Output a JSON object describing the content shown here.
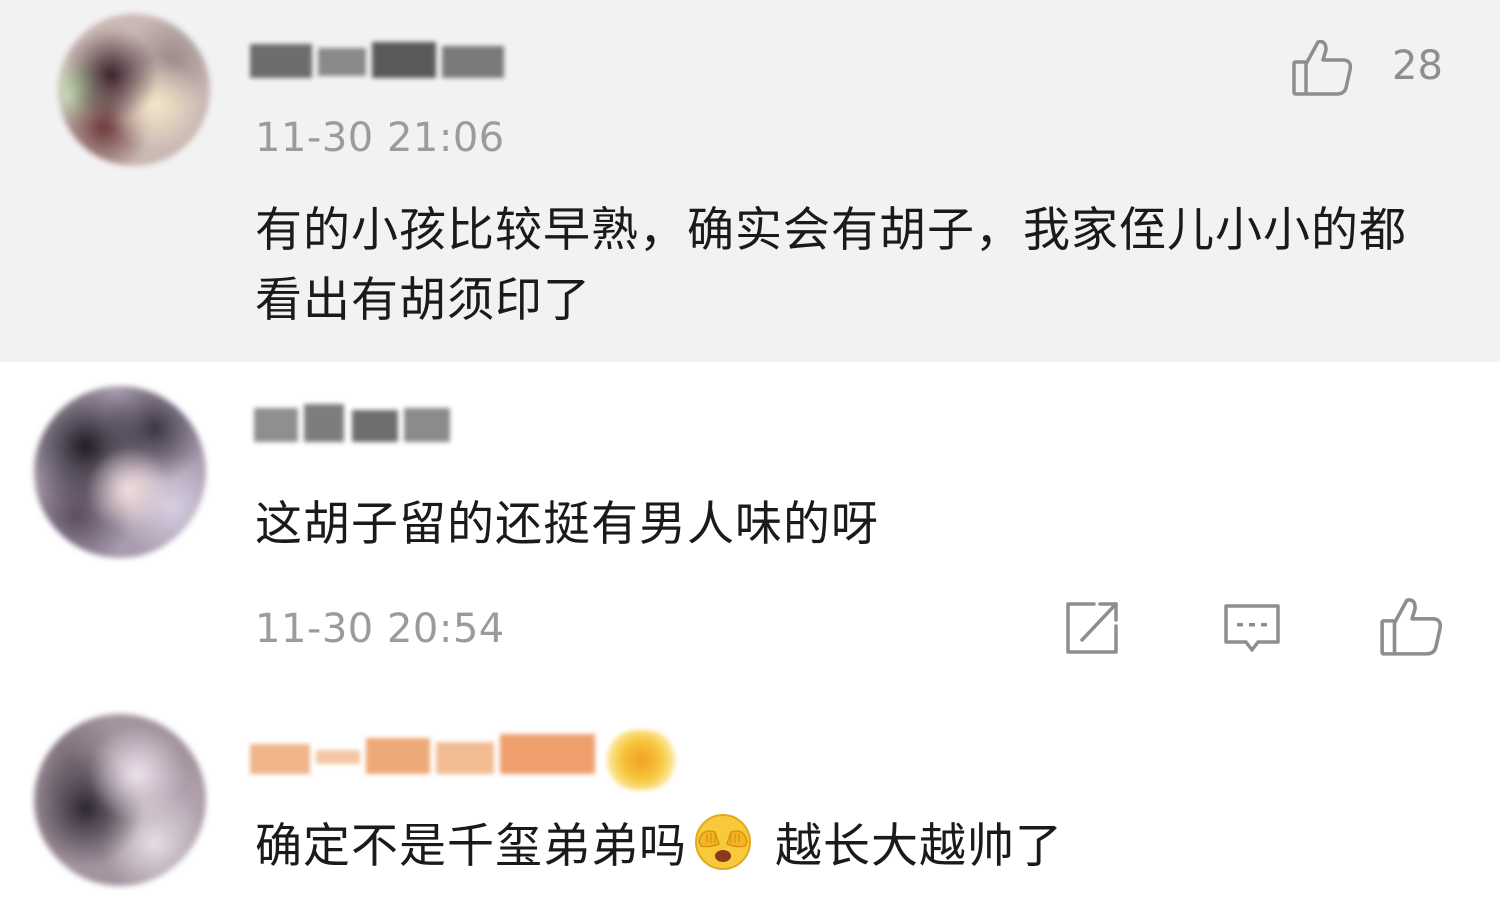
{
  "colors": {
    "highlight_background": "#f2f2f2",
    "text_primary": "#1a1a1a",
    "text_secondary": "#9b9b9b",
    "icon_stroke": "#8e8e8e"
  },
  "comments": [
    {
      "username": "",
      "timestamp": "11-30 21:06",
      "text": "有的小孩比较早熟，确实会有胡子，我家侄儿小小的都看出有胡须印了",
      "like_count": "28",
      "icons": {
        "like": "thumbs-up-icon"
      }
    },
    {
      "username": "",
      "timestamp": "11-30 20:54",
      "text": "这胡子留的还挺有男人味的呀",
      "icons": {
        "share": "share-icon",
        "reply": "comment-icon",
        "like": "thumbs-up-icon"
      }
    },
    {
      "username": "",
      "text_before_emoji": "确定不是千玺弟弟吗",
      "emoji": "see-no-evil-face-emoji",
      "text_after_emoji": " 越长大越帅了",
      "badge": "vip-badge"
    }
  ]
}
